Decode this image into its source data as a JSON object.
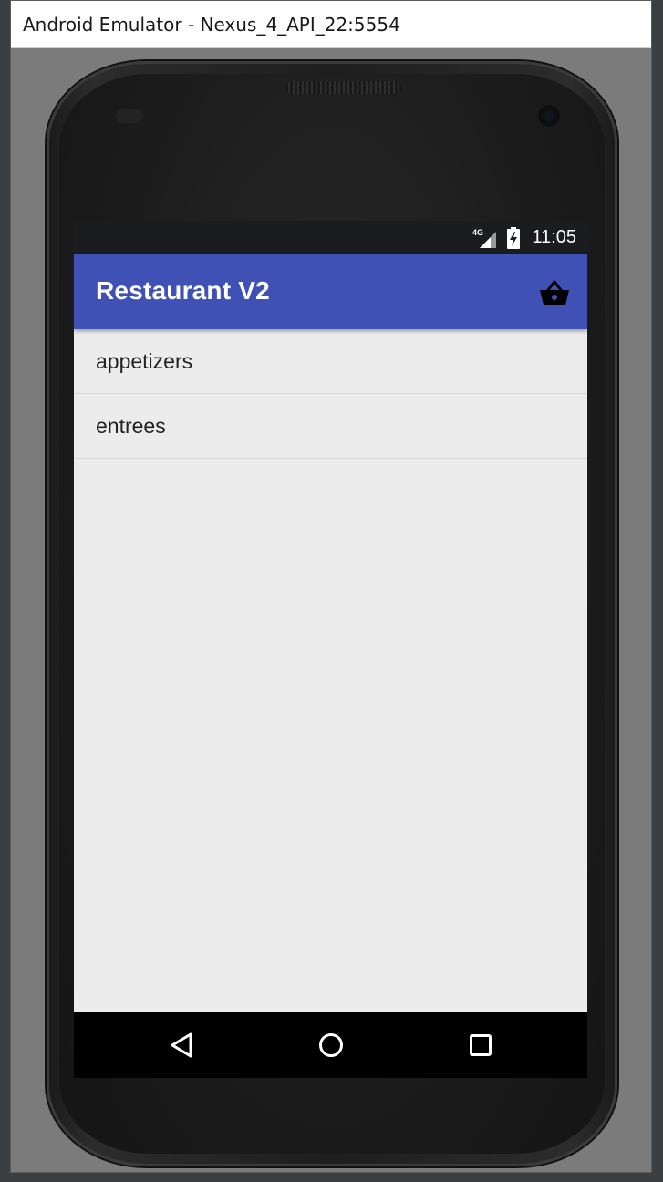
{
  "window": {
    "title": "Android Emulator - Nexus_4_API_22:5554"
  },
  "statusbar": {
    "network": "4G",
    "time": "11:05",
    "icons": [
      "signal-icon",
      "battery-charging-icon"
    ]
  },
  "appbar": {
    "title": "Restaurant V2",
    "action_icon": "shopping-basket-icon",
    "color": "#3f51b5"
  },
  "list": {
    "items": [
      {
        "label": "appetizers"
      },
      {
        "label": "entrees"
      }
    ]
  },
  "navbar": {
    "buttons": [
      "back-icon",
      "home-icon",
      "recents-icon"
    ]
  }
}
